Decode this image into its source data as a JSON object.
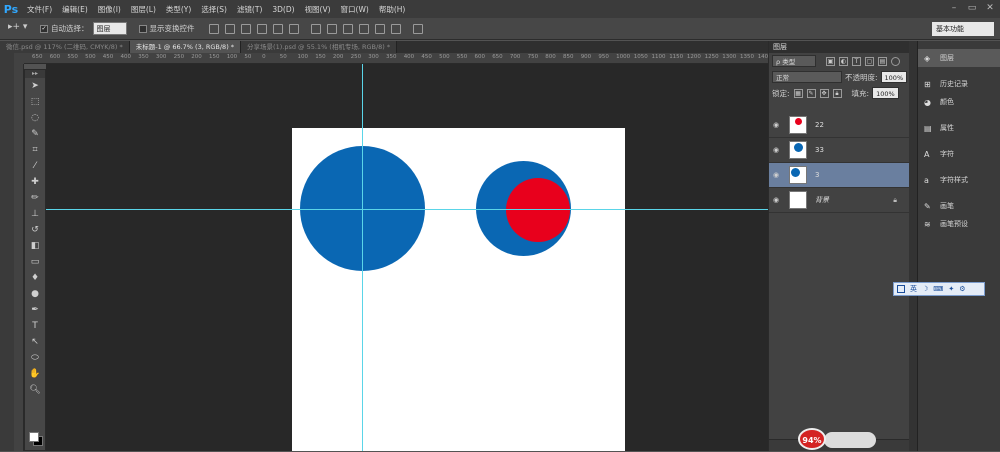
{
  "app": {
    "logo": "Ps"
  },
  "menu": [
    "文件(F)",
    "编辑(E)",
    "图像(I)",
    "图层(L)",
    "类型(Y)",
    "选择(S)",
    "滤镜(T)",
    "3D(D)",
    "视图(V)",
    "窗口(W)",
    "帮助(H)"
  ],
  "options": {
    "auto_select_label": "自动选择：",
    "auto_select_value": "图层",
    "show_transform_label": "显示变换控件",
    "workspace": "基本功能"
  },
  "tabs": [
    {
      "label": "微信.psd @ 117% (二维码, CMYK/8) *"
    },
    {
      "label": "未标题-1 @ 66.7% (3, RGB/8) *"
    },
    {
      "label": "分享场景(1).psd @ 55.1% (相机专场, RGB/8) *"
    }
  ],
  "ruler": {
    "ticks": [
      "650",
      "600",
      "550",
      "500",
      "450",
      "400",
      "350",
      "300",
      "250",
      "200",
      "150",
      "100",
      "50",
      "0",
      "50",
      "100",
      "150",
      "200",
      "250",
      "300",
      "350",
      "400",
      "450",
      "500",
      "550",
      "600",
      "650",
      "700",
      "750",
      "800",
      "850",
      "900",
      "950",
      "1000",
      "1050",
      "1100",
      "1150",
      "1200",
      "1250",
      "1300",
      "1350",
      "1400"
    ]
  },
  "canvas": {
    "colors": {
      "blue": "#0a67b3",
      "red": "#e8001c",
      "guide": "#5ad5e8",
      "doc": "#ffffff"
    }
  },
  "layers_panel": {
    "title": "图层",
    "filter_label": "ρ 类型",
    "blend_mode": "正常",
    "opacity_label": "不透明度:",
    "opacity_value": "100%",
    "lock_label": "锁定:",
    "fill_label": "填充:",
    "fill_value": "100%",
    "layers": [
      {
        "name": "22",
        "selected": false
      },
      {
        "name": "33",
        "selected": false
      },
      {
        "name": "3",
        "selected": true
      },
      {
        "name": "背景",
        "selected": false,
        "locked": true
      }
    ]
  },
  "dock": {
    "group1": [
      "图层"
    ],
    "group2": [
      "历史记录",
      "颜色"
    ],
    "group3": [
      "属性"
    ],
    "group4": [
      "字符"
    ],
    "group5": [
      "字符样式"
    ],
    "group6": [
      "画笔",
      "画笔预设"
    ]
  },
  "ime": {
    "items": [
      "英",
      "☽",
      "⌨",
      "✦",
      "⚙"
    ]
  },
  "speed_meter": {
    "value": "94%"
  }
}
